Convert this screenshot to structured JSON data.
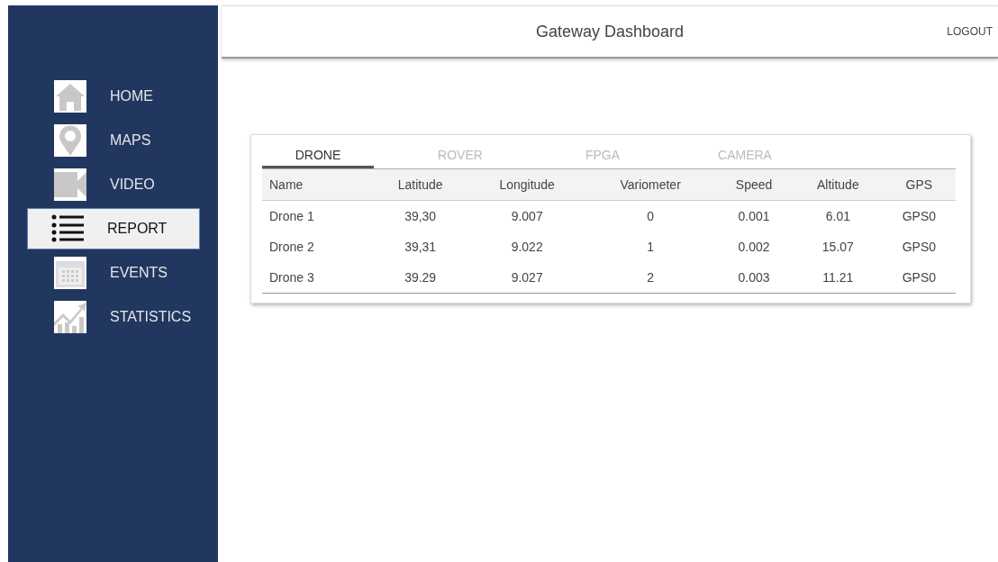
{
  "header": {
    "title": "Gateway Dashboard",
    "logout": "LOGOUT"
  },
  "sidebar": {
    "items": [
      {
        "label": "HOME",
        "kind": "home",
        "selected": false
      },
      {
        "label": "MAPS",
        "kind": "pin",
        "selected": false
      },
      {
        "label": "VIDEO",
        "kind": "video",
        "selected": false
      },
      {
        "label": "REPORT",
        "kind": "list",
        "selected": true
      },
      {
        "label": "EVENTS",
        "kind": "calendar",
        "selected": false
      },
      {
        "label": "STATISTICS",
        "kind": "chart",
        "selected": false
      }
    ]
  },
  "tabs": [
    {
      "label": "DRONE",
      "selected": true
    },
    {
      "label": "ROVER",
      "selected": false
    },
    {
      "label": "FPGA",
      "selected": false
    },
    {
      "label": "CAMERA",
      "selected": false
    }
  ],
  "table": {
    "columns": [
      "Name",
      "Latitude",
      "Longitude",
      "Variometer",
      "Speed",
      "Altitude",
      "GPS"
    ],
    "rows": [
      [
        "Drone 1",
        "39,30",
        "9.007",
        "0",
        "0.001",
        "6.01",
        "GPS0"
      ],
      [
        "Drone 2",
        "39,31",
        "9.022",
        "1",
        "0.002",
        "15.07",
        "GPS0"
      ],
      [
        "Drone 3",
        "39.29",
        "9.027",
        "2",
        "0.003",
        "11.21",
        "GPS0"
      ]
    ]
  }
}
